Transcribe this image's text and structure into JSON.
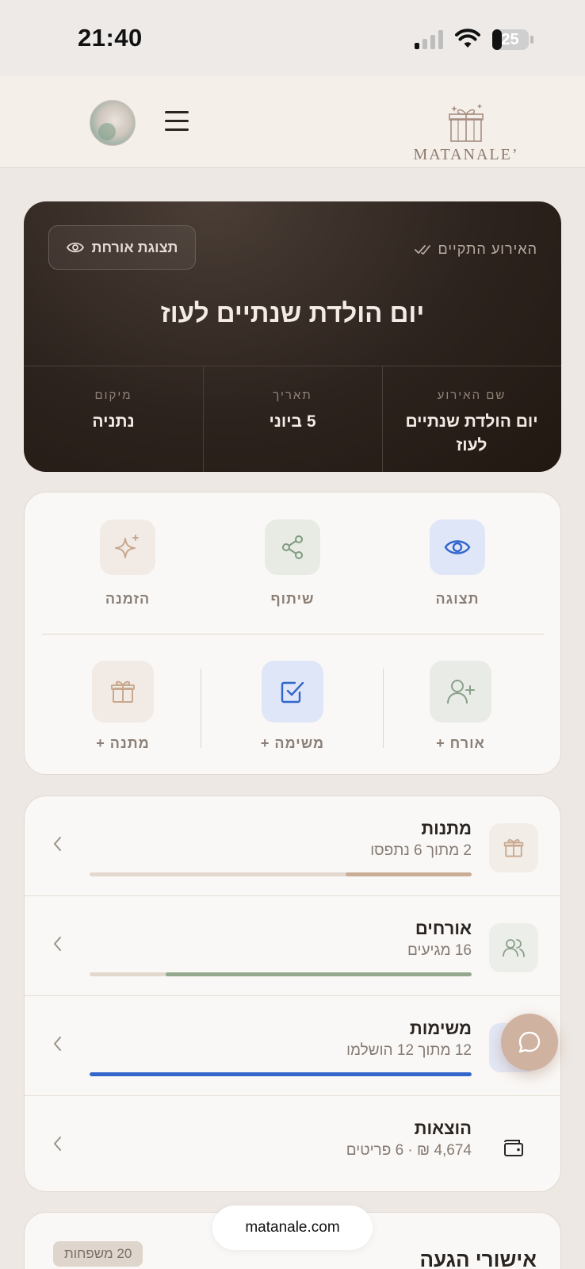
{
  "status_bar": {
    "time": "21:40",
    "battery": "25"
  },
  "header": {
    "logo_text": "MATANALE’"
  },
  "hero": {
    "status": "האירוע התקיים",
    "guest_view_label": "תצוגת אורחת",
    "title": "יום הולדת שנתיים לעוז",
    "details": [
      {
        "label": "שם האירוע",
        "value": "יום הולדת שנתיים לעוז"
      },
      {
        "label": "תאריך",
        "value": "5 ביוני"
      },
      {
        "label": "מיקום",
        "value": "נתניה"
      }
    ]
  },
  "actions": {
    "top": [
      {
        "label": "תצוגה",
        "icon": "eye-icon"
      },
      {
        "label": "שיתוף",
        "icon": "share-icon"
      },
      {
        "label": "הזמנה",
        "icon": "sparkle-icon"
      }
    ],
    "bottom": [
      {
        "label": "אורח +",
        "icon": "add-user-icon"
      },
      {
        "label": "משימה +",
        "icon": "checkbox-icon"
      },
      {
        "label": "מתנה +",
        "icon": "gift-icon"
      }
    ]
  },
  "summary": [
    {
      "title": "מתנות",
      "subtitle": "2 מתוך 6 נתפסו",
      "progress": 0.33,
      "color": "#c9ad97",
      "icon": "gift-icon"
    },
    {
      "title": "אורחים",
      "subtitle": "16 מגיעים",
      "progress": 0.8,
      "color": "#93a88c",
      "icon": "users-icon"
    },
    {
      "title": "משימות",
      "subtitle": "12 מתוך 12 הושלמו",
      "progress": 1.0,
      "color": "#3366cc",
      "icon": "tasks-icon"
    },
    {
      "title": "הוצאות",
      "subtitle": "4,674 ₪ · 6 פריטים",
      "icon": "wallet-icon"
    }
  ],
  "rsvp": {
    "title": "אישורי הגעה",
    "badge": "20 משפחות"
  },
  "url": "matanale.com",
  "colors": {
    "hero_bg": "#2d231e",
    "accent_tan": "#cfb29f",
    "accent_blue": "#3366cc",
    "accent_green": "#93a88c"
  }
}
